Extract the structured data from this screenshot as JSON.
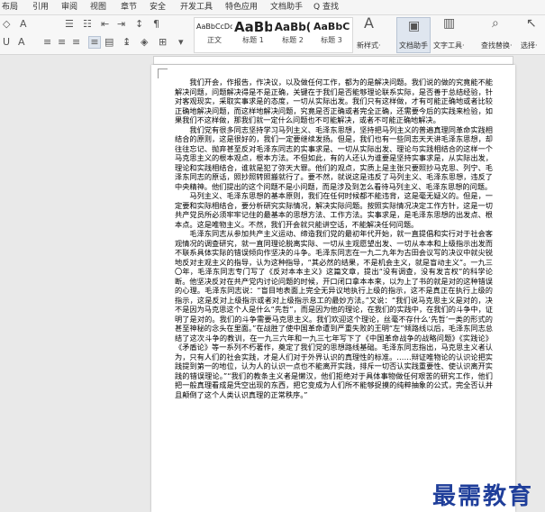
{
  "menu_tabs": [
    "布局",
    "引用",
    "审阅",
    "视图",
    "章节",
    "安全",
    "开发工具",
    "特色应用",
    "文档助手",
    "Q 查找"
  ],
  "toolbar": {
    "styles": [
      {
        "preview": "AaBbCcDd",
        "label": "正文"
      },
      {
        "preview": "AaBb",
        "label": "标题 1"
      },
      {
        "preview": "AaBb(",
        "label": "标题 2"
      },
      {
        "preview": "AaBbC",
        "label": "标题 3"
      }
    ],
    "new_style": "新样式·",
    "doc_assistant": "文档助手",
    "text_tools": "文字工具·",
    "find_replace": "查找替换·",
    "select": "选择·"
  },
  "paragraphs": [
    "我们开会，作报告，作决议，以及做任何工作，都为的是解决问题。我们说的做的究竟能不能解决问题，问题解决得是不是正确，关键在于我们是否能够理论联系实际，是否善于总结经验，针对客观现实，采取实事求是的态度，一切从实际出发。我们只有这样做，才有可能正确地或者比较正确地解决问题，而这样地解决问题，究竟是否正确或者完全正确，还需要今后的实践来检验，如果我们不这样做，那我们就一定什么问题也不可能解决，或者不可能正确地解决。",
    "我们党有很多同志坚持学习马列主义、毛泽东思想，坚持把马列主义的普遍真理同革命实践相结合的原则，这是很好的，我们一定要继续发扬。但是，我们也有一些同志天天讲毛泽东思想，却往往忘记、抛弃甚至反对毛泽东同志的实事求是、一切从实际出发、理论与实践相结合的这样一个马克思主义的根本观点，根本方法。不但如此，有的人还认为谁要是坚持实事求是，从实际出发，理论和实践相结合，谁就是犯了弥天大罪。他们的观点，实质上是主张只要照抄马克思、列宁、毛泽东同志的原话，照抄照转照搬就行了。要不然，就说这是违反了马列主义、毛泽东思想，违反了中央精神。他们提出的这个问题不是小问题，而是涉及到怎么看待马列主义、毛泽东思想的问题。",
    "马列主义、毛泽东思想的基本原则，我们在任何时候都不能违背，这是毫无疑义的。但是，一定要和实际相结合，要分析研究实际情况，解决实际问题。按照实际情况决定工作方针，这是一切共产党员所必须牢牢记住的最基本的思想方法、工作方法。实事求是，是毛泽东思想的出发点、根本点。这是唯物主义。不然，我们开会就只能讲空话，不能解决任何问题。",
    "毛泽东同志从参加共产主义运动、缔造我们党的最初年代开始，就一直提倡和实行对于社会客观情况的调查研究，就一直同理论脱离实际、一切从主观愿望出发、一切从本本和上级指示出发而不联系具体实际的错误倾向作坚决的斗争。毛泽东同志在一九二九年为古田会议写的决议中就尖锐地反对主观主义的指导，认为这种指导，“其必然的结果，不是机会主义，就是盲动主义”。一九三〇年，毛泽东同志专门写了《反对本本主义》这篇文章，提出“没有调查，没有发言权”的科学论断。他坚决反对在共产党内讨论问题的时候，开口闭口拿本本来，以为上了书的就是对的这种错误的心理。毛泽东同志说：“盲目地表面上完全无异议地执行上级的指示，这不是真正在执行上级的指示，这是反对上级指示或者对上级指示怠工的最妙方法。”又说：“我们说马克思主义是对的，决不是因为马克思这个人是什么“先哲”，而是因为他的理论，在我们的实践中，在我们的斗争中，证明了是对的。我们的斗争需要马克思主义。我们欢迎这个理论，丝毫不存什么‘先哲’一类的形式的甚至神秘的念头在里面。”在战胜了使中国革命遭到严重失败的王明“左”倾路线以后，毛泽东同志总结了这次斗争的教训，在一九三六年和一九三七年写下了《中国革命战争的战略问题》《实践论》《矛盾论》等一系列不朽著作，奠定了我们党的思想路线基础。毛泽东同志指出，马克思主义者认为，只有人们的社会实践，才是人们对于外界认识的真理性的标准。……辩证唯物论的认识论把实践提到第一的地位，认为人的认识一点也不能离开实践，排斥一切否认实践重要性、使认识离开实践的错误理论。”“我们的教条主义者是懒汉，他们拒绝对于具体事物做任何艰苦的研究工作，他们把一般真理看成是凭空出现的东西，把它变成为人们所不能够捉摸的纯粹抽象的公式，完全否认并且颠倒了这个人类认识真理的正常秩序。”"
  ],
  "watermark": "最需教育"
}
